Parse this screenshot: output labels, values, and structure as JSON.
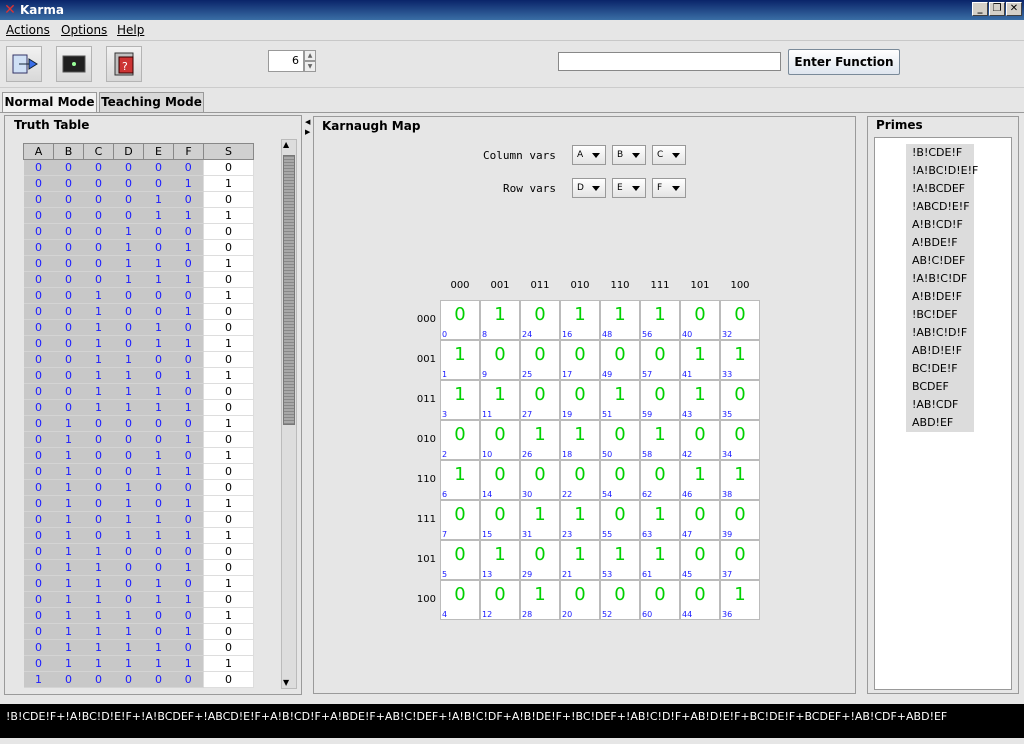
{
  "window": {
    "title": "Karma"
  },
  "menu": [
    "Actions",
    "Options",
    "Help"
  ],
  "toolbar": {
    "spinner_value": "6",
    "function_input": "",
    "enter_label": "Enter Function"
  },
  "tabs": [
    "Normal Mode",
    "Teaching Mode"
  ],
  "truth_table": {
    "title": "Truth Table",
    "columns": [
      "A",
      "B",
      "C",
      "D",
      "E",
      "F",
      "S"
    ],
    "rows": [
      [
        "0",
        "0",
        "0",
        "0",
        "0",
        "0",
        "0"
      ],
      [
        "0",
        "0",
        "0",
        "0",
        "0",
        "1",
        "1"
      ],
      [
        "0",
        "0",
        "0",
        "0",
        "1",
        "0",
        "0"
      ],
      [
        "0",
        "0",
        "0",
        "0",
        "1",
        "1",
        "1"
      ],
      [
        "0",
        "0",
        "0",
        "1",
        "0",
        "0",
        "0"
      ],
      [
        "0",
        "0",
        "0",
        "1",
        "0",
        "1",
        "0"
      ],
      [
        "0",
        "0",
        "0",
        "1",
        "1",
        "0",
        "1"
      ],
      [
        "0",
        "0",
        "0",
        "1",
        "1",
        "1",
        "0"
      ],
      [
        "0",
        "0",
        "1",
        "0",
        "0",
        "0",
        "1"
      ],
      [
        "0",
        "0",
        "1",
        "0",
        "0",
        "1",
        "0"
      ],
      [
        "0",
        "0",
        "1",
        "0",
        "1",
        "0",
        "0"
      ],
      [
        "0",
        "0",
        "1",
        "0",
        "1",
        "1",
        "1"
      ],
      [
        "0",
        "0",
        "1",
        "1",
        "0",
        "0",
        "0"
      ],
      [
        "0",
        "0",
        "1",
        "1",
        "0",
        "1",
        "1"
      ],
      [
        "0",
        "0",
        "1",
        "1",
        "1",
        "0",
        "0"
      ],
      [
        "0",
        "0",
        "1",
        "1",
        "1",
        "1",
        "0"
      ],
      [
        "0",
        "1",
        "0",
        "0",
        "0",
        "0",
        "1"
      ],
      [
        "0",
        "1",
        "0",
        "0",
        "0",
        "1",
        "0"
      ],
      [
        "0",
        "1",
        "0",
        "0",
        "1",
        "0",
        "1"
      ],
      [
        "0",
        "1",
        "0",
        "0",
        "1",
        "1",
        "0"
      ],
      [
        "0",
        "1",
        "0",
        "1",
        "0",
        "0",
        "0"
      ],
      [
        "0",
        "1",
        "0",
        "1",
        "0",
        "1",
        "1"
      ],
      [
        "0",
        "1",
        "0",
        "1",
        "1",
        "0",
        "0"
      ],
      [
        "0",
        "1",
        "0",
        "1",
        "1",
        "1",
        "1"
      ],
      [
        "0",
        "1",
        "1",
        "0",
        "0",
        "0",
        "0"
      ],
      [
        "0",
        "1",
        "1",
        "0",
        "0",
        "1",
        "0"
      ],
      [
        "0",
        "1",
        "1",
        "0",
        "1",
        "0",
        "1"
      ],
      [
        "0",
        "1",
        "1",
        "0",
        "1",
        "1",
        "0"
      ],
      [
        "0",
        "1",
        "1",
        "1",
        "0",
        "0",
        "1"
      ],
      [
        "0",
        "1",
        "1",
        "1",
        "0",
        "1",
        "0"
      ],
      [
        "0",
        "1",
        "1",
        "1",
        "1",
        "0",
        "0"
      ],
      [
        "0",
        "1",
        "1",
        "1",
        "1",
        "1",
        "1"
      ],
      [
        "1",
        "0",
        "0",
        "0",
        "0",
        "0",
        "0"
      ]
    ]
  },
  "karnaugh": {
    "title": "Karnaugh Map",
    "column_vars_label": "Column vars",
    "row_vars_label": "Row vars",
    "column_vars": [
      "A",
      "B",
      "C"
    ],
    "row_vars": [
      "D",
      "E",
      "F"
    ],
    "col_headers": [
      "000",
      "001",
      "011",
      "010",
      "110",
      "111",
      "101",
      "100"
    ],
    "row_headers": [
      "000",
      "001",
      "011",
      "010",
      "110",
      "111",
      "101",
      "100"
    ],
    "values": [
      [
        "0",
        "1",
        "0",
        "1",
        "1",
        "1",
        "0",
        "0"
      ],
      [
        "1",
        "0",
        "0",
        "0",
        "0",
        "0",
        "1",
        "1"
      ],
      [
        "1",
        "1",
        "0",
        "0",
        "1",
        "0",
        "1",
        "0"
      ],
      [
        "0",
        "0",
        "1",
        "1",
        "0",
        "1",
        "0",
        "0"
      ],
      [
        "1",
        "0",
        "0",
        "0",
        "0",
        "0",
        "1",
        "1"
      ],
      [
        "0",
        "0",
        "1",
        "1",
        "0",
        "1",
        "0",
        "0"
      ],
      [
        "0",
        "1",
        "0",
        "1",
        "1",
        "1",
        "0",
        "0"
      ],
      [
        "0",
        "0",
        "1",
        "0",
        "0",
        "0",
        "0",
        "1"
      ]
    ],
    "indices": [
      [
        "0",
        "8",
        "24",
        "16",
        "48",
        "56",
        "40",
        "32"
      ],
      [
        "1",
        "9",
        "25",
        "17",
        "49",
        "57",
        "41",
        "33"
      ],
      [
        "3",
        "11",
        "27",
        "19",
        "51",
        "59",
        "43",
        "35"
      ],
      [
        "2",
        "10",
        "26",
        "18",
        "50",
        "58",
        "42",
        "34"
      ],
      [
        "6",
        "14",
        "30",
        "22",
        "54",
        "62",
        "46",
        "38"
      ],
      [
        "7",
        "15",
        "31",
        "23",
        "55",
        "63",
        "47",
        "39"
      ],
      [
        "5",
        "13",
        "29",
        "21",
        "53",
        "61",
        "45",
        "37"
      ],
      [
        "4",
        "12",
        "28",
        "20",
        "52",
        "60",
        "44",
        "36"
      ]
    ]
  },
  "primes": {
    "title": "Primes",
    "items": [
      "!B!CDE!F",
      "!A!BC!D!E!F",
      "!A!BCDEF",
      "!ABCD!E!F",
      "A!B!CD!F",
      "A!BDE!F",
      "AB!C!DEF",
      "!A!B!C!DF",
      "A!B!DE!F",
      "!BC!DEF",
      "!AB!C!D!F",
      "AB!D!E!F",
      "BC!DE!F",
      "BCDEF",
      "!AB!CDF",
      "ABD!EF"
    ]
  },
  "status": {
    "expression": "!B!CDE!F+!A!BC!D!E!F+!A!BCDEF+!ABCD!E!F+A!B!CD!F+A!BDE!F+AB!C!DEF+!A!B!C!DF+A!B!DE!F+!BC!DEF+!AB!C!D!F+AB!D!E!F+BC!DE!F+BCDEF+!AB!CDF+ABD!EF"
  }
}
